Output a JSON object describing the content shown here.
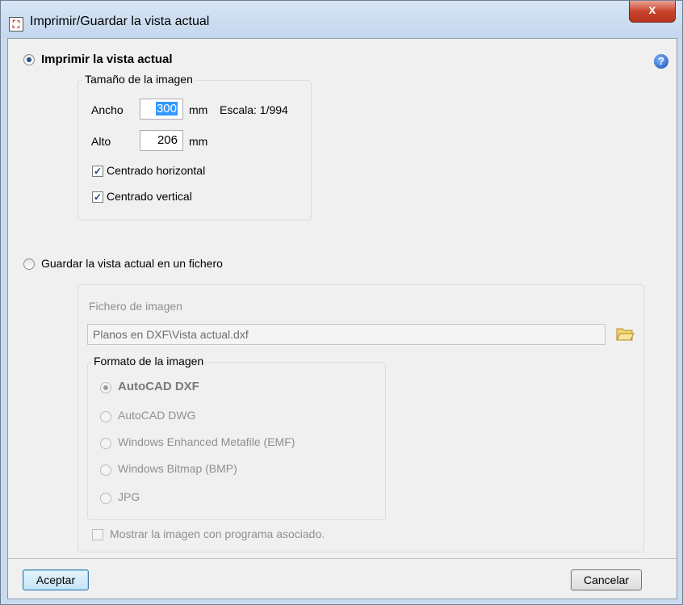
{
  "window": {
    "title": "Imprimir/Guardar la vista actual",
    "close_glyph": "x"
  },
  "print_section": {
    "radio_label": "Imprimir la vista actual",
    "group_label": "Tamaño de la imagen",
    "ancho_label": "Ancho",
    "ancho_value": "300",
    "ancho_unit": "mm",
    "escala_text": "Escala: 1/994",
    "alto_label": "Alto",
    "alto_value": "206",
    "alto_unit": "mm",
    "centrado_horizontal": "Centrado horizontal",
    "centrado_vertical": "Centrado vertical",
    "selected": true
  },
  "save_section": {
    "radio_label": "Guardar la vista actual en un fichero",
    "file_label": "Fichero de imagen",
    "file_value": "Planos en DXF\\Vista actual.dxf",
    "format_group_label": "Formato de la imagen",
    "formats": [
      "AutoCAD DXF",
      "AutoCAD DWG",
      "Windows Enhanced Metafile (EMF)",
      "Windows Bitmap (BMP)",
      "JPG"
    ],
    "selected_format": "AutoCAD DXF",
    "show_with_program": "Mostrar la imagen con programa asociado."
  },
  "footer": {
    "accept_label": "Aceptar",
    "cancel_label": "Cancelar"
  },
  "icons": {
    "help": "help-icon",
    "folder": "folder-open-icon",
    "app": "app-icon"
  }
}
